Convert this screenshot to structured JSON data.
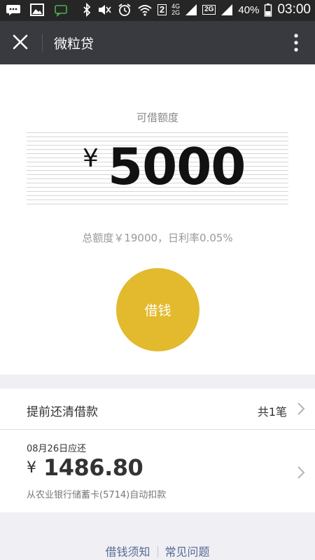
{
  "status_bar": {
    "battery": "40%",
    "time": "03:00",
    "sim_badge": "2",
    "network_4g": "4G",
    "network_2g_top": "2G",
    "network_2g_badge": "2G"
  },
  "title_bar": {
    "title": "微粒贷"
  },
  "main": {
    "quota_label": "可借额度",
    "currency": "¥",
    "available_amount": "5000",
    "total_line": "总额度￥19000，日利率0.05%",
    "borrow_button": "借钱"
  },
  "repay_row": {
    "label": "提前还清借款",
    "count": "共1笔"
  },
  "bill": {
    "due_date": "08月26日应还",
    "currency": "¥",
    "amount": "1486.80",
    "source": "从农业银行储蓄卡(5714)自动扣款"
  },
  "footer": {
    "link_1": "借钱须知",
    "link_2": "常见问题"
  },
  "colors": {
    "accent_button": "#e3ba2d",
    "title_bar": "#393a3f",
    "status_bar": "#262626",
    "link": "#576b95"
  }
}
